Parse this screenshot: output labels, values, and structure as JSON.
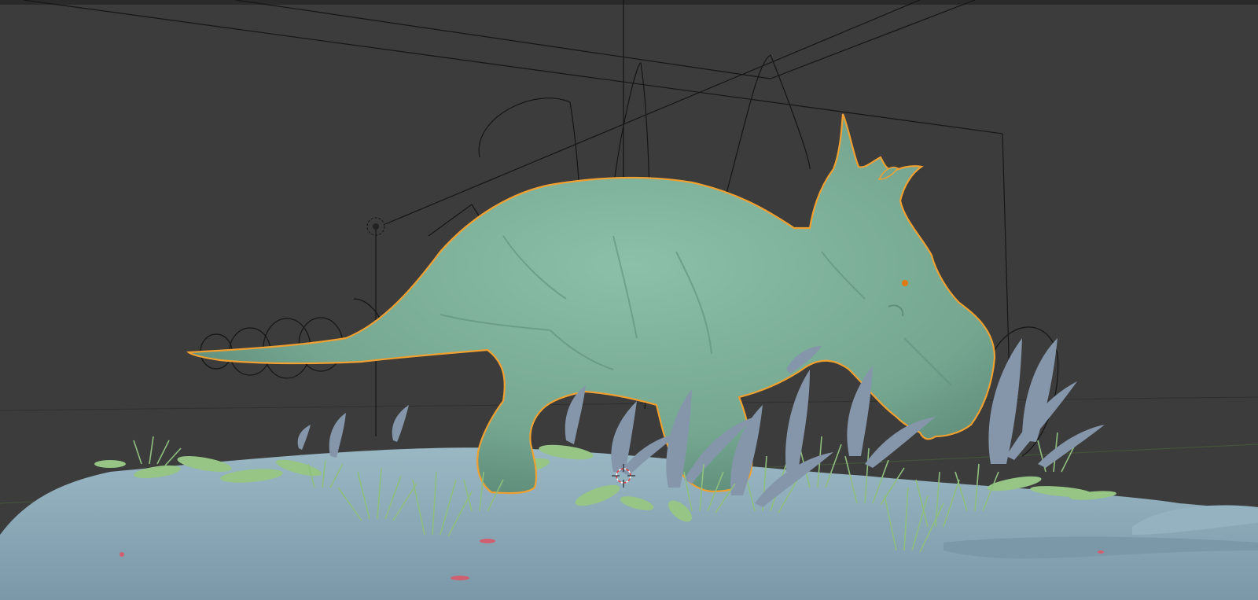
{
  "viewport": {
    "mode": "3d-viewport",
    "selected_object": "dinosaur",
    "colors": {
      "background": "#3c3c3c",
      "dinosaur": "#7fb09a",
      "selection_outline": "#f0a030",
      "ground": "#8fb0bd",
      "grass": "#90c080",
      "leaves": "#8a9aae",
      "rig_lines": "#1a1a1a",
      "cursor_red": "#e04040"
    }
  }
}
